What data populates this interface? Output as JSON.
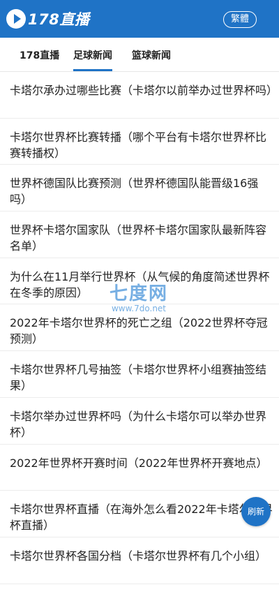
{
  "header": {
    "logo_text": "178直播",
    "lang_button": "繁體"
  },
  "tabs": [
    {
      "label": "178直播"
    },
    {
      "label": "足球新闻"
    },
    {
      "label": "篮球新闻"
    }
  ],
  "articles": [
    {
      "title": "卡塔尔承办过哪些比赛（卡塔尔以前举办过世界杯吗）"
    },
    {
      "title": "卡塔尔世界杯比赛转播（哪个平台有卡塔尔世界杯比赛转播权）"
    },
    {
      "title": "世界杯德国队比赛预测（世界杯德国队能晋级16强吗）"
    },
    {
      "title": "世界杯卡塔尔国家队（世界杯卡塔尔国家队最新阵容名单）"
    },
    {
      "title": "为什么在11月举行世界杯（从气候的角度简述世界杯在冬季的原因）"
    },
    {
      "title": "2022年卡塔尔世界杯的死亡之组（2022世界杯夺冠预测）"
    },
    {
      "title": "卡塔尔世界杯几号抽签（卡塔尔世界杯小组赛抽签结果）"
    },
    {
      "title": "卡塔尔举办过世界杯吗（为什么卡塔尔可以举办世界杯）"
    },
    {
      "title": "2022年世界杯开赛时间（2022年世界杯开赛地点）"
    },
    {
      "title": "卡塔尔世界杯直播（在海外怎么看2022年卡塔尔世界杯直播）"
    },
    {
      "title": "卡塔尔世界杯各国分档（卡塔尔世界杯有几个小组）"
    }
  ],
  "watermark": {
    "main": "七度网",
    "url": "www.7do.net"
  },
  "refresh_label": "刷新",
  "colors": {
    "brand": "#1f73c6",
    "divider": "#ececec"
  }
}
